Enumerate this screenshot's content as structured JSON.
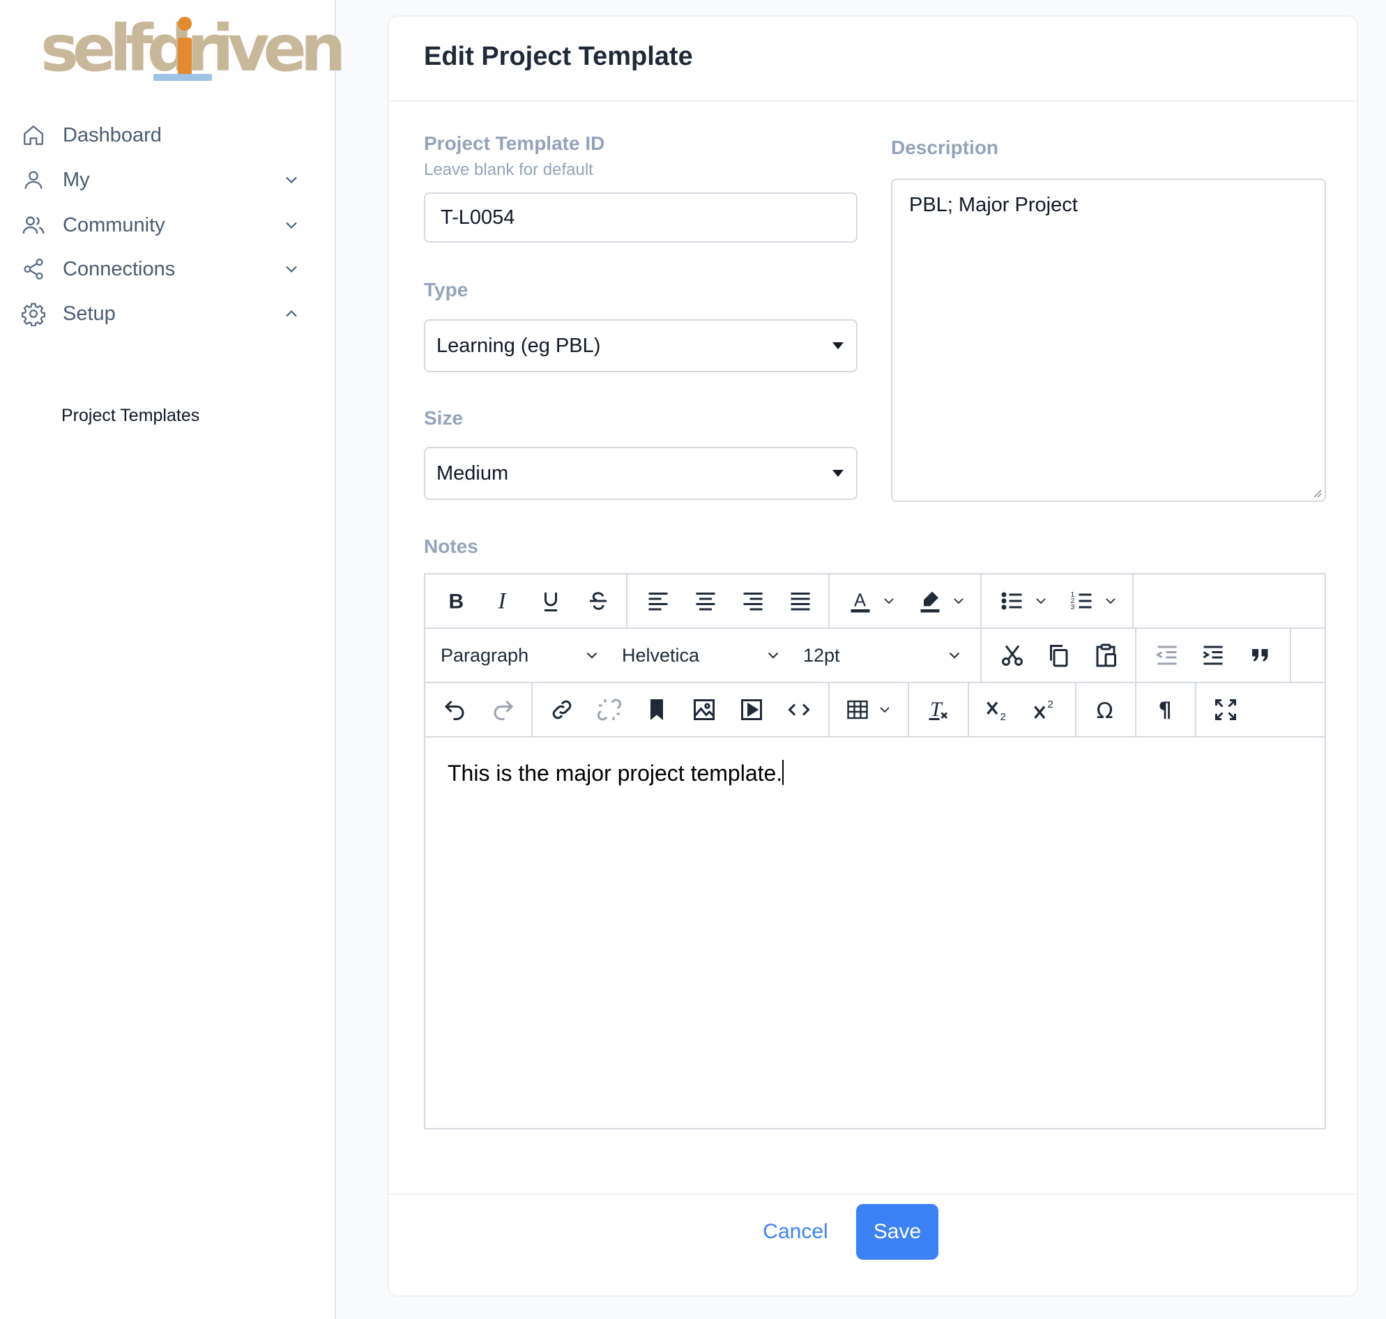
{
  "brand": {
    "logo_text": "selfdriven",
    "colors": {
      "logo": "#c8b89a",
      "logo_i": "#e3892e",
      "logo_underline": "#9fc3e6",
      "accent": "#3b82f6"
    }
  },
  "sidebar": {
    "items": [
      {
        "label": "Dashboard",
        "icon": "home-icon"
      },
      {
        "label": "My",
        "icon": "user-icon",
        "chevron": "down"
      },
      {
        "label": "Community",
        "icon": "users-icon",
        "chevron": "down"
      },
      {
        "label": "Connections",
        "icon": "share-icon",
        "chevron": "down"
      },
      {
        "label": "Setup",
        "icon": "gear-icon",
        "chevron": "up"
      }
    ],
    "sub_items": [
      {
        "label": "Project Templates"
      }
    ]
  },
  "form": {
    "title": "Edit Project Template",
    "template_id": {
      "label": "Project Template ID",
      "hint": "Leave blank for default",
      "value": "T-L0054"
    },
    "type": {
      "label": "Type",
      "value": "Learning (eg PBL)"
    },
    "size": {
      "label": "Size",
      "value": "Medium"
    },
    "description": {
      "label": "Description",
      "value": "PBL; Major Project"
    },
    "notes": {
      "label": "Notes",
      "block_format": "Paragraph",
      "font_family": "Helvetica",
      "font_size": "12pt",
      "content": "This is the major project template."
    },
    "buttons": {
      "cancel": "Cancel",
      "save": "Save"
    }
  }
}
